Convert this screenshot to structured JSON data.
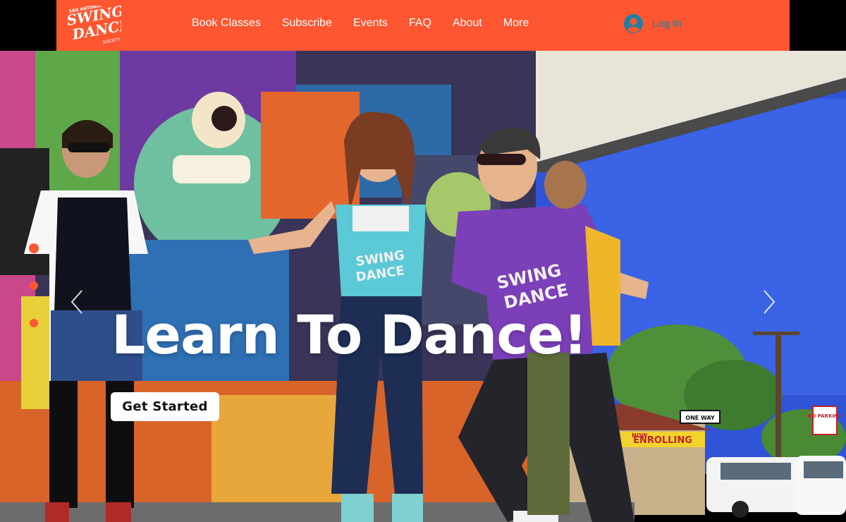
{
  "header": {
    "logo_text_top": "SAN ANTONIO",
    "logo_text_main_1": "SWING",
    "logo_text_main_2": "DANCE",
    "logo_text_bottom": "SOCIETY",
    "brand_color": "#fe5630",
    "nav": [
      {
        "label": "Book Classes"
      },
      {
        "label": "Subscribe"
      },
      {
        "label": "Events"
      },
      {
        "label": "FAQ"
      },
      {
        "label": "About"
      },
      {
        "label": "More"
      }
    ],
    "login_label": "Log In",
    "login_icon": "user-avatar-icon",
    "login_color": "#1f7fa3"
  },
  "hero": {
    "headline": "Learn To Dance!",
    "cta_label": "Get Started",
    "slides_total": 3,
    "active_slide": 1,
    "prev_icon": "chevron-left-icon",
    "next_icon": "chevron-right-icon",
    "shirt_text_1": "SWING",
    "shirt_text_2": "DANCE",
    "sign_one_way": "ONE WAY",
    "sign_enrolling": "ENROLLING",
    "sign_now": "NOW",
    "sign_no_parking": "NO PARKING"
  }
}
